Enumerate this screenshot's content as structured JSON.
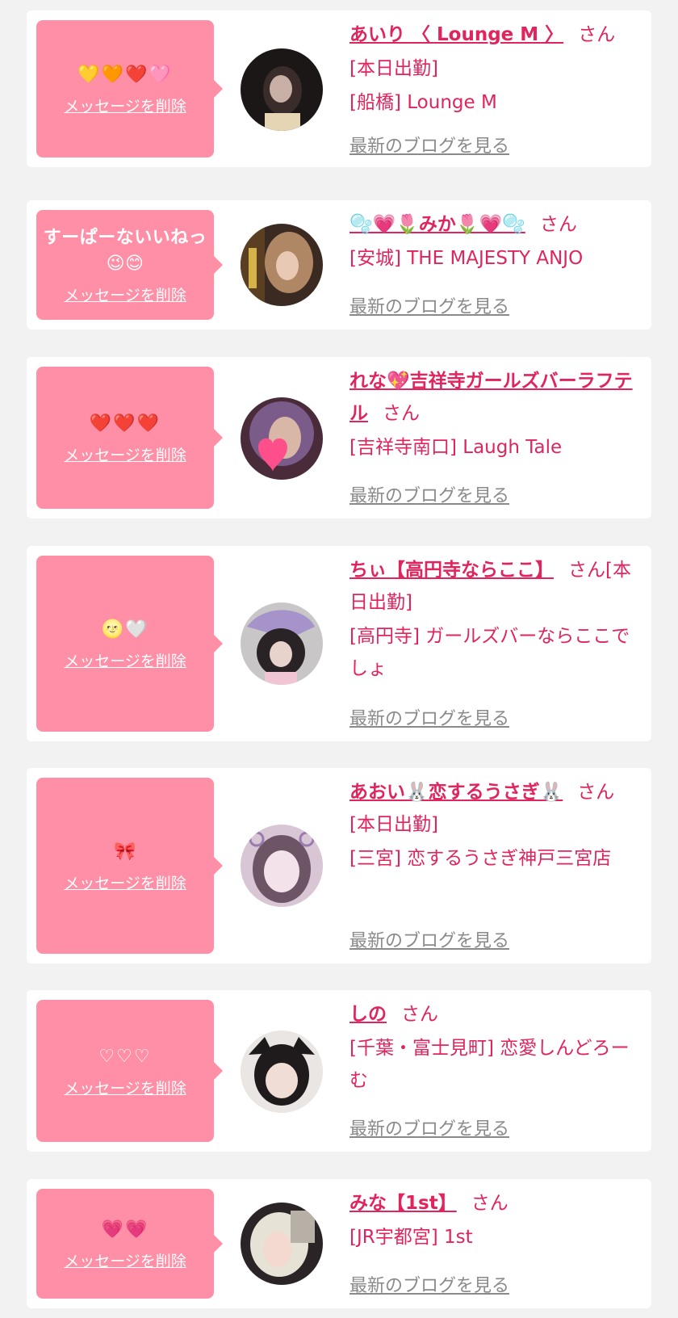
{
  "colors": {
    "page_bg": "#f2f2f2",
    "card_bg": "#ffffff",
    "bubble_bg": "#ff8fa6",
    "accent": "#e0245e",
    "link_gray": "#8a8a8a"
  },
  "labels": {
    "delete": "メッセージを削除",
    "blog": "最新のブログを見る",
    "san": "さん"
  },
  "items": [
    {
      "message": "💛🧡❤️🩷",
      "name": "あいり 〈 Lounge M 〉",
      "lines": [
        "[本日出勤]",
        "[船橋] Lounge M"
      ],
      "avatar_icon": "profile-photo"
    },
    {
      "message": "すーぱーないいねっ😉😊",
      "name": "🫧💗🌷みか🌷💗🫧",
      "lines": [
        "[安城] THE MAJESTY ANJO"
      ],
      "avatar_icon": "profile-photo"
    },
    {
      "message": "❤️❤️❤️",
      "name": "れな💖吉祥寺ガールズバーラフテル",
      "lines": [
        "[吉祥寺南口] Laugh Tale"
      ],
      "avatar_icon": "profile-photo"
    },
    {
      "message": "🌝🤍",
      "name": "ちぃ【高円寺ならここ】",
      "lines": [
        "[本日出勤]",
        "[高円寺] ガールズバーならここでしょ"
      ],
      "avatar_icon": "profile-photo"
    },
    {
      "message": "🎀",
      "name": "あおい🐰恋するうさぎ🐰",
      "lines": [
        "[本日出勤]",
        "[三宮] 恋するうさぎ神戸三宮店"
      ],
      "avatar_icon": "profile-photo"
    },
    {
      "message": "♡♡♡",
      "name": "しの",
      "lines": [
        "[千葉・富士見町] 恋愛しんどろーむ"
      ],
      "avatar_icon": "profile-photo"
    },
    {
      "message": "💗💗",
      "name": "みな【1st】",
      "lines": [
        "[JR宇都宮] 1st"
      ],
      "avatar_icon": "profile-photo"
    }
  ]
}
